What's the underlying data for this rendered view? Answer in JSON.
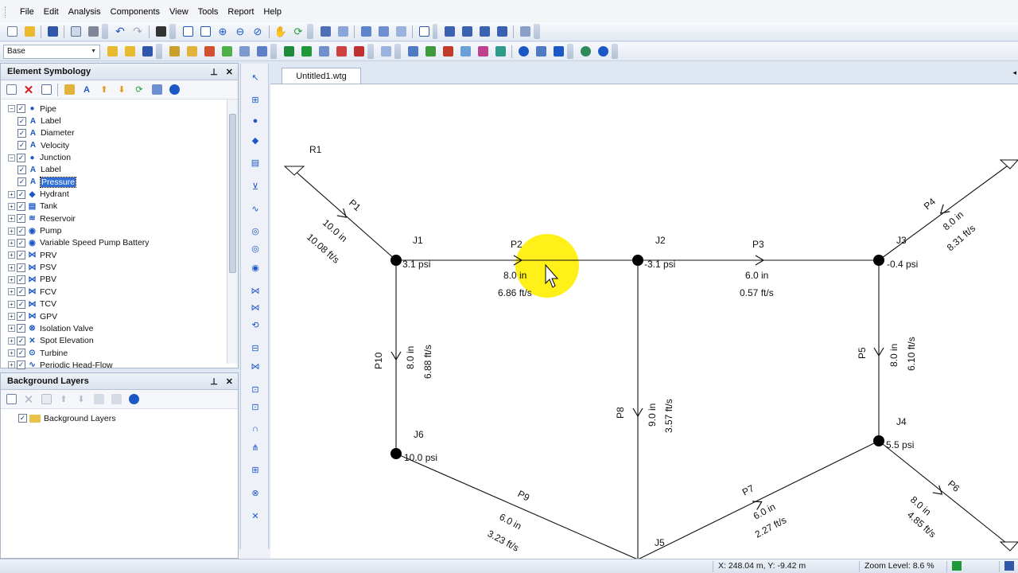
{
  "menu": [
    "File",
    "Edit",
    "Analysis",
    "Components",
    "View",
    "Tools",
    "Report",
    "Help"
  ],
  "toolbar2": {
    "scenario_combo": "Base"
  },
  "element_symbology": {
    "title": "Element Symbology",
    "rows": [
      {
        "label": "Pipe",
        "expanded": true,
        "icon": "pipe-icon"
      },
      {
        "label": "Label",
        "child": true,
        "icon": "annotation-icon"
      },
      {
        "label": "Diameter",
        "child": true,
        "icon": "annotation-icon"
      },
      {
        "label": "Velocity",
        "child": true,
        "icon": "annotation-icon"
      },
      {
        "label": "Junction",
        "expanded": true,
        "icon": "junction-icon"
      },
      {
        "label": "Label",
        "child": true,
        "icon": "annotation-icon"
      },
      {
        "label": "Pressure",
        "child": true,
        "icon": "annotation-icon",
        "selected": true
      },
      {
        "label": "Hydrant",
        "icon": "hydrant-icon"
      },
      {
        "label": "Tank",
        "icon": "tank-icon"
      },
      {
        "label": "Reservoir",
        "icon": "reservoir-icon"
      },
      {
        "label": "Pump",
        "icon": "pump-icon"
      },
      {
        "label": "Variable Speed Pump Battery",
        "icon": "pump-battery-icon"
      },
      {
        "label": "PRV",
        "icon": "valve-icon"
      },
      {
        "label": "PSV",
        "icon": "valve-icon"
      },
      {
        "label": "PBV",
        "icon": "valve-icon"
      },
      {
        "label": "FCV",
        "icon": "valve-icon"
      },
      {
        "label": "TCV",
        "icon": "valve-icon"
      },
      {
        "label": "GPV",
        "icon": "valve-icon"
      },
      {
        "label": "Isolation Valve",
        "icon": "isolation-valve-icon"
      },
      {
        "label": "Spot Elevation",
        "icon": "spot-elevation-icon"
      },
      {
        "label": "Turbine",
        "icon": "turbine-icon"
      },
      {
        "label": "Periodic Head-Flow",
        "icon": "periodic-head-flow-icon"
      }
    ]
  },
  "background_layers": {
    "title": "Background Layers",
    "rows": [
      {
        "label": "Background Layers"
      }
    ]
  },
  "document_tab": "Untitled1.wtg",
  "network": {
    "nodes": {
      "R1": {
        "label": "R1"
      },
      "J1": {
        "label": "J1",
        "pressure": "3.1 psi"
      },
      "J2": {
        "label": "J2",
        "pressure": "-3.1 psi"
      },
      "J3": {
        "label": "J3",
        "pressure": "-0.4 psi"
      },
      "J4": {
        "label": "J4",
        "pressure": "5.5 psi"
      },
      "J5": {
        "label": "J5"
      },
      "J6": {
        "label": "J6",
        "pressure": "10.0 psi"
      }
    },
    "pipes": {
      "P1": {
        "label": "P1",
        "diameter": "10.0 in",
        "velocity": "10.08 ft/s"
      },
      "P2": {
        "label": "P2",
        "diameter": "8.0 in",
        "velocity": "6.86 ft/s"
      },
      "P3": {
        "label": "P3",
        "diameter": "6.0 in",
        "velocity": "0.57 ft/s"
      },
      "P4": {
        "label": "P4",
        "diameter": "8.0 in",
        "velocity": "8.31 ft/s"
      },
      "P5": {
        "label": "P5",
        "diameter": "8.0 in",
        "velocity": "6.10 ft/s"
      },
      "P6": {
        "label": "P6",
        "diameter": "8.0 in",
        "velocity": "4.85 ft/s"
      },
      "P7": {
        "label": "P7",
        "diameter": "6.0 in",
        "velocity": "2.27 ft/s"
      },
      "P8": {
        "label": "P8",
        "diameter": "9.0 in",
        "velocity": "3.57 ft/s"
      },
      "P9": {
        "label": "P9",
        "diameter": "6.0 in",
        "velocity": "3.23 ft/s"
      },
      "P10": {
        "label": "P10",
        "diameter": "8.0 in",
        "velocity": "6.88 ft/s"
      }
    }
  },
  "status": {
    "coordinates": "X: 248.04 m, Y: -9.42 m",
    "zoom": "Zoom Level: 8.6 %"
  },
  "colors": {
    "highlight": "#ffee00",
    "accent": "#1b57c5"
  }
}
